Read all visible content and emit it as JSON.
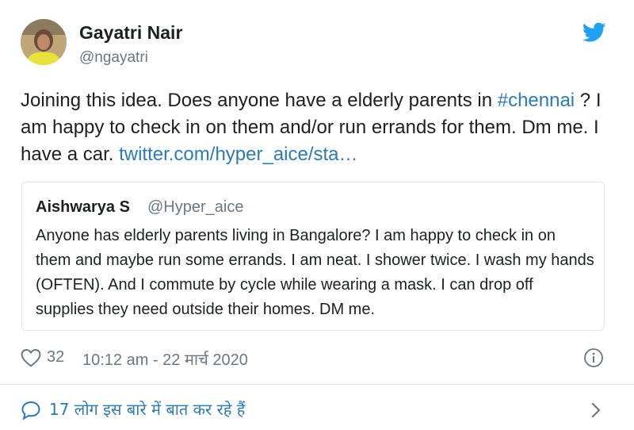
{
  "author": {
    "name": "Gayatri Nair",
    "handle": "@ngayatri"
  },
  "tweet": {
    "text_part1": "Joining this idea. Does anyone have a elderly parents in ",
    "hashtag": "#chennai",
    "text_part2": " ? I am happy to check in on them and/or run errands for them. Dm me. I have a car. ",
    "link": "twitter.com/hyper_aice/sta…"
  },
  "quoted": {
    "name": "Aishwarya S",
    "handle": "@Hyper_aice",
    "text": "Anyone has elderly parents living in Bangalore? I am happy to check in on them and maybe run some errands. I am neat. I shower twice. I wash my hands (OFTEN). And I commute by cycle while wearing a mask. I can drop off supplies they need outside their homes. DM me."
  },
  "meta": {
    "likes": "32",
    "timestamp": "10:12 am - 22 मार्च 2020"
  },
  "footer": {
    "label": "17 लोग इस बारे में बात कर रहे हैं"
  },
  "icons": {
    "brand": "twitter-bird-icon",
    "like": "heart-icon",
    "info": "info-icon",
    "reply": "speech-bubble-icon",
    "next": "chevron-right-icon"
  },
  "colors": {
    "link": "#2b7bb9",
    "brand": "#1da1f2",
    "muted": "#697882",
    "border": "#e1e8ed"
  }
}
